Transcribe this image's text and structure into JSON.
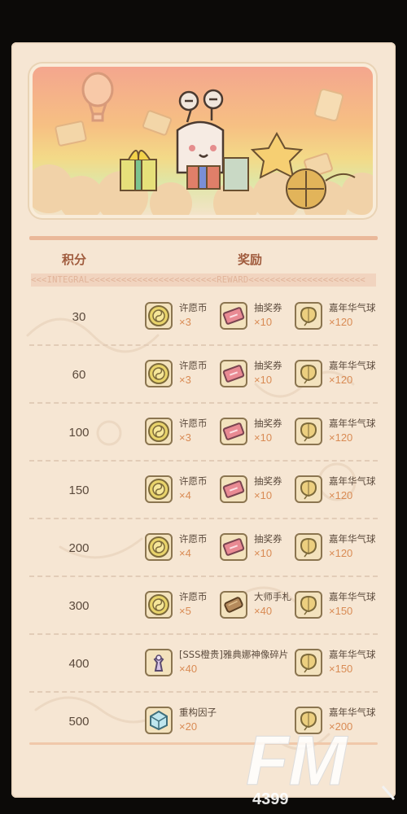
{
  "header": {
    "score_label": "积分",
    "reward_label": "奖励",
    "subtitle": "<<<INTEGRAL<<<<<<<<<<<<<<<<<<<<<<<<REWARD<<<<<<<<<<<<<<<<<<<<<<"
  },
  "rows": [
    {
      "score": "30",
      "rewards": [
        {
          "name": "许愿币",
          "qty": "×3",
          "icon": "wish-coin-icon"
        },
        {
          "name": "抽奖券",
          "qty": "×10",
          "icon": "lottery-ticket-icon"
        },
        {
          "name": "嘉年华气球",
          "qty": "×120",
          "icon": "carnival-balloon-icon"
        }
      ]
    },
    {
      "score": "60",
      "rewards": [
        {
          "name": "许愿币",
          "qty": "×3",
          "icon": "wish-coin-icon"
        },
        {
          "name": "抽奖券",
          "qty": "×10",
          "icon": "lottery-ticket-icon"
        },
        {
          "name": "嘉年华气球",
          "qty": "×120",
          "icon": "carnival-balloon-icon"
        }
      ]
    },
    {
      "score": "100",
      "rewards": [
        {
          "name": "许愿币",
          "qty": "×3",
          "icon": "wish-coin-icon"
        },
        {
          "name": "抽奖券",
          "qty": "×10",
          "icon": "lottery-ticket-icon"
        },
        {
          "name": "嘉年华气球",
          "qty": "×120",
          "icon": "carnival-balloon-icon"
        }
      ]
    },
    {
      "score": "150",
      "rewards": [
        {
          "name": "许愿币",
          "qty": "×4",
          "icon": "wish-coin-icon"
        },
        {
          "name": "抽奖券",
          "qty": "×10",
          "icon": "lottery-ticket-icon"
        },
        {
          "name": "嘉年华气球",
          "qty": "×120",
          "icon": "carnival-balloon-icon"
        }
      ]
    },
    {
      "score": "200",
      "rewards": [
        {
          "name": "许愿币",
          "qty": "×4",
          "icon": "wish-coin-icon"
        },
        {
          "name": "抽奖券",
          "qty": "×10",
          "icon": "lottery-ticket-icon"
        },
        {
          "name": "嘉年华气球",
          "qty": "×120",
          "icon": "carnival-balloon-icon"
        }
      ]
    },
    {
      "score": "300",
      "rewards": [
        {
          "name": "许愿币",
          "qty": "×5",
          "icon": "wish-coin-icon"
        },
        {
          "name": "大师手札",
          "qty": "×40",
          "icon": "master-notes-icon"
        },
        {
          "name": "嘉年华气球",
          "qty": "×150",
          "icon": "carnival-balloon-icon"
        }
      ]
    },
    {
      "score": "400",
      "rewards": [
        {
          "name": "[SSS橙贵]雅典娜神像碎片",
          "qty": "×40",
          "icon": "athena-statue-shard-icon"
        },
        {
          "name": "嘉年华气球",
          "qty": "×150",
          "icon": "carnival-balloon-icon"
        }
      ]
    },
    {
      "score": "500",
      "rewards": [
        {
          "name": "重构因子",
          "qty": "×20",
          "icon": "reconstruct-factor-icon"
        },
        {
          "name": "嘉年华气球",
          "qty": "×200",
          "icon": "carnival-balloon-icon"
        }
      ]
    }
  ],
  "watermark": {
    "big": "FM",
    "small": "4399"
  },
  "colors": {
    "panel": "#f6e6d3",
    "accent": "#eab899",
    "score_text": "#5b4a3c",
    "qty_text": "#d98b54",
    "header_text": "#a05c3e"
  }
}
